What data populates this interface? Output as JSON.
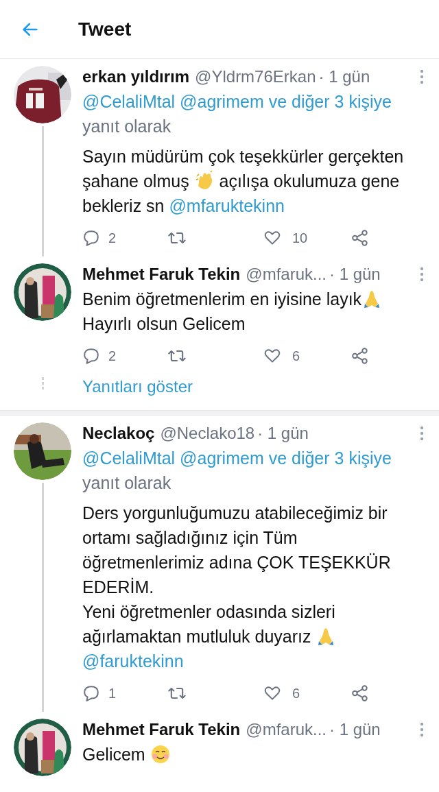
{
  "header": {
    "title": "Tweet"
  },
  "tweets": [
    {
      "name": "erkan yıldırım",
      "handle": "@Yldrm76Erkan",
      "time": "· 1 gün",
      "thread_line": true,
      "reply_to": [
        {
          "kind": "mention",
          "text": "@CelaliMtal"
        },
        {
          "kind": "mention",
          "text": "@agrimem ve diğer 3 kişiye"
        },
        {
          "kind": "break"
        },
        {
          "kind": "text",
          "text": "yanıt olarak"
        }
      ],
      "body": [
        {
          "kind": "text",
          "text": "Sayın müdürüm çok teşekkürler gerçekten şahane olmuş "
        },
        {
          "kind": "clap"
        },
        {
          "kind": "text",
          "text": " açılışa okulumuza gene bekleriz sn "
        },
        {
          "kind": "mention",
          "text": "@mfaruktekinn"
        }
      ],
      "replies": "2",
      "likes": "10"
    },
    {
      "name": "Mehmet Faruk Tekin",
      "handle": "@mfaruk...",
      "time": "· 1 gün",
      "thread_line": false,
      "body": [
        {
          "kind": "text",
          "text": "Benim öğretmenlerim en iyisine layık"
        },
        {
          "kind": "pray"
        },
        {
          "kind": "break"
        },
        {
          "kind": "text",
          "text": "Hayırlı olsun Gelicem"
        }
      ],
      "replies": "2",
      "likes": "6",
      "show_replies": "Yanıtları göster"
    },
    {
      "name": "Neclakoç",
      "handle": "@Neclako18",
      "time": "· 1 gün",
      "thread_line": true,
      "reply_to": [
        {
          "kind": "mention",
          "text": "@CelaliMtal"
        },
        {
          "kind": "mention",
          "text": "@agrimem ve diğer 3 kişiye"
        },
        {
          "kind": "break"
        },
        {
          "kind": "text",
          "text": "yanıt olarak"
        }
      ],
      "body": [
        {
          "kind": "text",
          "text": "Ders yorgunluğumuzu atabileceğimiz bir ortamı sağladığınız için Tüm öğretmenlerimiz adına ÇOK TEŞEKKÜR EDERİM."
        },
        {
          "kind": "break"
        },
        {
          "kind": "text",
          "text": "Yeni öğretmenler odasında sizleri ağırlamaktan mutluluk duyarız "
        },
        {
          "kind": "pray"
        },
        {
          "kind": "break"
        },
        {
          "kind": "mention",
          "text": "@faruktekinn"
        }
      ],
      "replies": "1",
      "likes": "6"
    },
    {
      "name": "Mehmet Faruk Tekin",
      "handle": "@mfaruk...",
      "time": "· 1 gün",
      "thread_line": false,
      "body": [
        {
          "kind": "text",
          "text": "Gelicem "
        },
        {
          "kind": "smile"
        }
      ]
    }
  ]
}
